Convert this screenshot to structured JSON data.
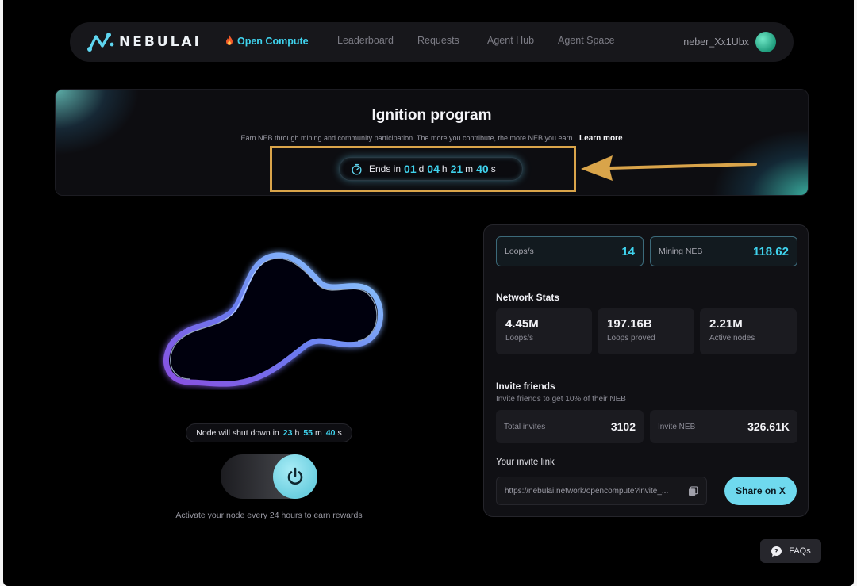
{
  "brand": {
    "name": "NEBULAI"
  },
  "nav": {
    "items": [
      {
        "label": "Open Compute",
        "active": true
      },
      {
        "label": "Leaderboard"
      },
      {
        "label": "Requests"
      },
      {
        "label": "Agent Hub"
      },
      {
        "label": "Agent Space"
      }
    ],
    "username": "neber_Xx1Ubx"
  },
  "banner": {
    "title": "Ignition program",
    "description": "Earn NEB through mining and community participation. The more you contribute, the more NEB you earn.",
    "learn_more": "Learn more",
    "countdown": {
      "prefix": "Ends in",
      "days": "01",
      "days_unit": "d",
      "hours": "04",
      "hours_unit": "h",
      "minutes": "21",
      "minutes_unit": "m",
      "seconds": "40",
      "seconds_unit": "s"
    }
  },
  "node": {
    "shutdown_prefix": "Node will shut down in",
    "hours": "23",
    "hours_unit": "h",
    "minutes": "55",
    "minutes_unit": "m",
    "seconds": "40",
    "seconds_unit": "s",
    "activate_text": "Activate your node every 24 hours to earn rewards"
  },
  "mining": {
    "loops_label": "Loops/s",
    "loops_value": "14",
    "neb_label": "Mining NEB",
    "neb_value": "118.62"
  },
  "network": {
    "title": "Network Stats",
    "cards": [
      {
        "value": "4.45M",
        "label": "Loops/s"
      },
      {
        "value": "197.16B",
        "label": "Loops proved"
      },
      {
        "value": "2.21M",
        "label": "Active nodes"
      }
    ]
  },
  "invite": {
    "title": "Invite friends",
    "subtitle": "Invite friends to get 10% of their NEB",
    "total_label": "Total invites",
    "total_value": "3102",
    "neb_label": "Invite NEB",
    "neb_value": "326.61K",
    "link_title": "Your invite link",
    "link_url": "https://nebulai.network/opencompute?invite_...",
    "share_label": "Share on X"
  },
  "faq": {
    "label": "FAQs"
  },
  "colors": {
    "accent": "#3fd3ee",
    "highlight": "#d9a44a",
    "button": "#6fd9ee"
  }
}
